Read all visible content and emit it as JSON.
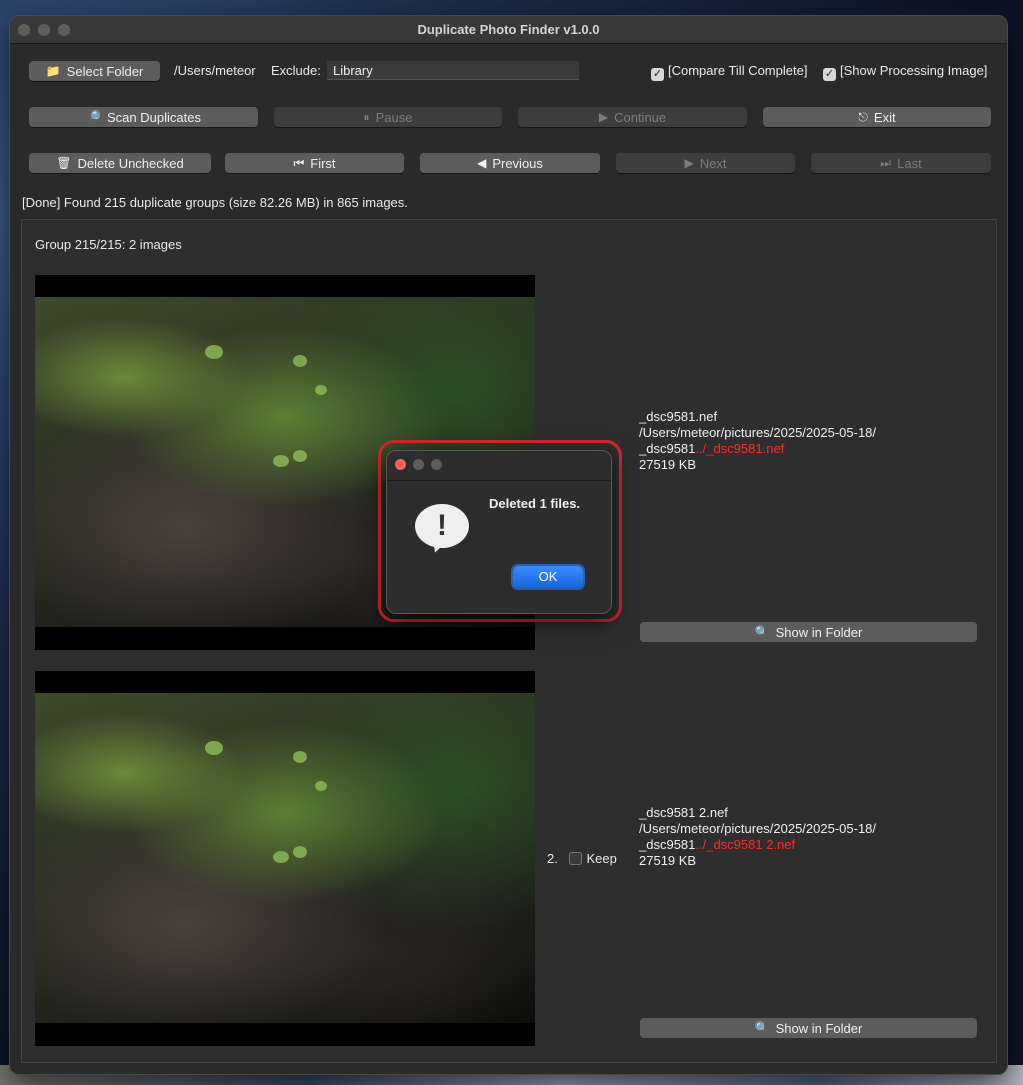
{
  "window": {
    "title": "Duplicate Photo Finder v1.0.0"
  },
  "toolbar": {
    "select_folder_label": "Select Folder",
    "folder_path": "/Users/meteor",
    "exclude_label": "Exclude:",
    "exclude_value": "Library",
    "compare_till_complete": {
      "label": "[Compare Till Complete]",
      "checked": true
    },
    "show_processing_image": {
      "label": "[Show Processing Image]",
      "checked": true
    },
    "scan_label": "Scan Duplicates",
    "pause_label": "Pause",
    "continue_label": "Continue",
    "exit_label": "Exit",
    "delete_unchecked_label": "Delete Unchecked",
    "first_label": "First",
    "previous_label": "Previous",
    "next_label": "Next",
    "last_label": "Last"
  },
  "status": "[Done] Found 215 duplicate groups (size 82.26 MB) in 865 images.",
  "group": {
    "header": "Group 215/215: 2 images",
    "items": [
      {
        "filename": "_dsc9581.nef",
        "path": "/Users/meteor/pictures/2025/2025-05-18/",
        "short_prefix": "_dsc9581",
        "short_suffix": "../_dsc9581.nef",
        "size": "27519 KB",
        "show_in_folder_label": "Show in Folder"
      },
      {
        "index": "2.",
        "keep_label": "Keep",
        "keep_checked": false,
        "filename": "_dsc9581 2.nef",
        "path": "/Users/meteor/pictures/2025/2025-05-18/",
        "short_prefix": "_dsc9581",
        "short_suffix": "../_dsc9581 2.nef",
        "size": "27519 KB",
        "show_in_folder_label": "Show in Folder"
      }
    ]
  },
  "dialog": {
    "message": "Deleted 1 files.",
    "ok_label": "OK",
    "highlight_color": "#d8262c"
  }
}
